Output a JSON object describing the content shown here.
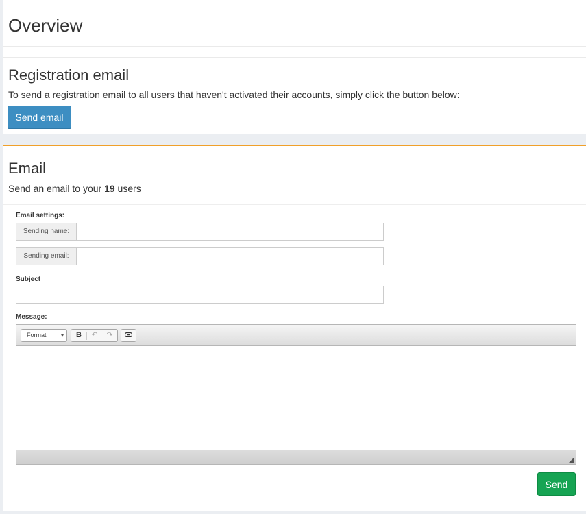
{
  "overview": {
    "title": "Overview"
  },
  "registration": {
    "title": "Registration email",
    "description": "To send a registration email to all users that haven't activated their accounts, simply click the button below:",
    "button_label": "Send email"
  },
  "email": {
    "title": "Email",
    "description_prefix": "Send an email to your ",
    "user_count": "19",
    "description_suffix": " users",
    "settings_label": "Email settings:",
    "sending_name_label": "Sending name:",
    "sending_name_value": "",
    "sending_email_label": "Sending email:",
    "sending_email_value": "",
    "subject_label": "Subject",
    "subject_value": "",
    "message_label": "Message:",
    "toolbar": {
      "format_label": "Format",
      "bold_label": "B",
      "undo_icon": "undo-icon",
      "redo_icon": "redo-icon",
      "link_icon": "link-icon"
    },
    "send_label": "Send"
  },
  "colors": {
    "accent_orange": "#f0a02a",
    "primary_blue": "#3d8ec2",
    "success_green": "#16a453"
  }
}
